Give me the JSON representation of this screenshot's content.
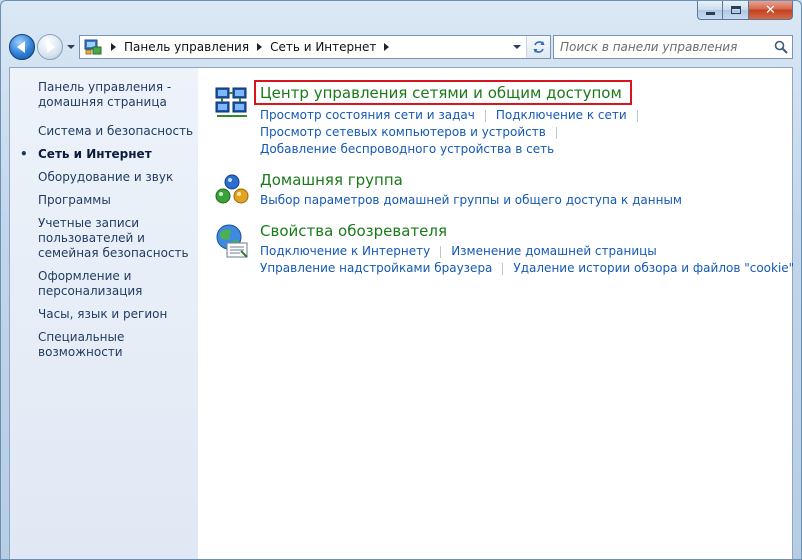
{
  "nav": {
    "breadcrumbs": [
      "Панель управления",
      "Сеть и Интернет"
    ]
  },
  "search": {
    "placeholder": "Поиск в панели управления"
  },
  "sidebar": {
    "items": [
      "Панель управления - домашняя страница",
      "Система и безопасность",
      "Сеть и Интернет",
      "Оборудование и звук",
      "Программы",
      "Учетные записи пользователей и семейная безопасность",
      "Оформление и персонализация",
      "Часы, язык и регион",
      "Специальные возможности"
    ]
  },
  "categories": [
    {
      "title": "Центр управления сетями и общим доступом",
      "links": [
        [
          "Просмотр состояния сети и задач",
          "Подключение к сети"
        ],
        [
          "Просмотр сетевых компьютеров и устройств"
        ],
        [
          "Добавление беспроводного устройства в сеть"
        ]
      ]
    },
    {
      "title": "Домашняя группа",
      "links": [
        [
          "Выбор параметров домашней группы и общего доступа к данным"
        ]
      ]
    },
    {
      "title": "Свойства обозревателя",
      "links": [
        [
          "Подключение к Интернету",
          "Изменение домашней страницы"
        ],
        [
          "Управление надстройками браузера",
          "Удаление истории обзора и файлов \"cookie\""
        ]
      ]
    }
  ],
  "colors": {
    "category_title": "#1a7a1a",
    "link": "#1559b5",
    "highlight_border": "#d6161c"
  }
}
